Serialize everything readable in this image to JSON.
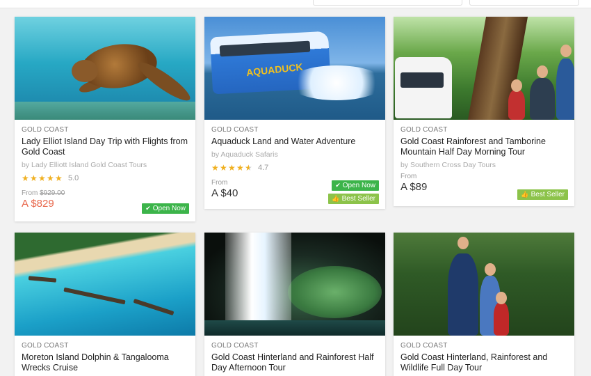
{
  "cards": [
    {
      "region": "GOLD COAST",
      "title": "Lady Elliot Island Day Trip with Flights from Gold Coast",
      "operator": "by Lady Elliott Island Gold Coast Tours",
      "rating": "5.0",
      "stars": 5,
      "from_label": "From",
      "was_price": "$929.00",
      "price": "A $829",
      "badges": [
        {
          "label": "Open Now",
          "icon": "check-icon"
        }
      ],
      "image_subject": "sea turtle underwater"
    },
    {
      "region": "GOLD COAST",
      "title": "Aquaduck Land and Water Adventure",
      "operator": "by Aquaduck Safaris",
      "rating": "4.7",
      "stars": 4.5,
      "from_label": "From",
      "price": "A $40",
      "badges": [
        {
          "label": "Open Now",
          "icon": "check-icon"
        },
        {
          "label": "Best Seller",
          "icon": "thumbs-up-icon"
        }
      ],
      "image_subject": "amphibious bus splashing",
      "image_text": "AQUADUCK"
    },
    {
      "region": "GOLD COAST",
      "title": "Gold Coast Rainforest and Tamborine Mountain Half Day Morning Tour",
      "operator": "by Southern Cross Day Tours",
      "from_label": "From",
      "price": "A $89",
      "badges": [
        {
          "label": "Best Seller",
          "icon": "thumbs-up-icon"
        }
      ],
      "image_subject": "rainforest tour with van"
    },
    {
      "region": "GOLD COAST",
      "title": "Moreton Island Dolphin & Tangalooma Wrecks Cruise",
      "image_subject": "aerial view of island wrecks"
    },
    {
      "region": "GOLD COAST",
      "title": "Gold Coast Hinterland and Rainforest Half Day Afternoon Tour",
      "image_subject": "waterfall in cave"
    },
    {
      "region": "GOLD COAST",
      "title": "Gold Coast Hinterland, Rainforest and Wildlife Full Day Tour",
      "image_subject": "guide with family in rainforest"
    }
  ],
  "colors": {
    "sale_price": "#e8664a",
    "open_now": "#3cb44a",
    "best_seller": "#8cc34a",
    "star": "#f0b020"
  }
}
